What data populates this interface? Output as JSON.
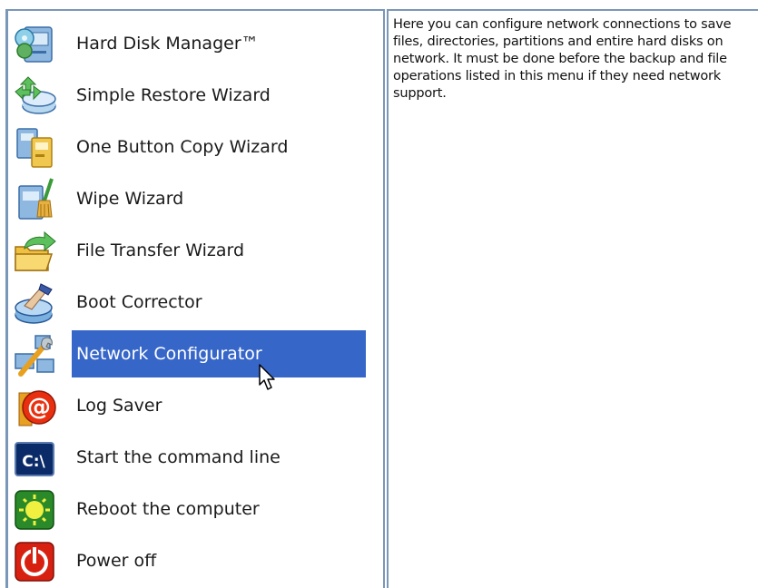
{
  "menu": {
    "items": [
      {
        "label": "Hard Disk Manager™",
        "icon": "hard-disk-manager-icon"
      },
      {
        "label": "Simple Restore Wizard",
        "icon": "restore-icon"
      },
      {
        "label": "One Button Copy Wizard",
        "icon": "copy-icon"
      },
      {
        "label": "Wipe Wizard",
        "icon": "wipe-icon"
      },
      {
        "label": "File Transfer Wizard",
        "icon": "file-transfer-icon"
      },
      {
        "label": "Boot Corrector",
        "icon": "boot-corrector-icon"
      },
      {
        "label": "Network Configurator",
        "icon": "network-configurator-icon",
        "selected": true
      },
      {
        "label": "Log Saver",
        "icon": "log-saver-icon"
      },
      {
        "label": "Start the command line",
        "icon": "command-line-icon"
      },
      {
        "label": "Reboot the computer",
        "icon": "reboot-icon"
      },
      {
        "label": "Power off",
        "icon": "power-off-icon"
      }
    ],
    "selected_color": "#3666c8"
  },
  "description": {
    "text": "Here you can configure network connections to save files, directories, partitions and entire hard disks on network. It must be done before the backup and file operations listed in this menu if they need network support."
  },
  "colors": {
    "border": "#7a96b8",
    "selection": "#3666c8"
  }
}
